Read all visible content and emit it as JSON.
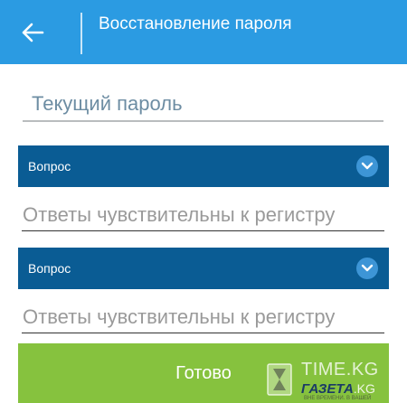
{
  "appbar": {
    "title": "Восстановление пароля",
    "color": "#2b9be2"
  },
  "form": {
    "current_password_placeholder": "Текущий пароль",
    "questions": [
      {
        "label": "Вопрос",
        "answer_placeholder": "Ответы чувствительны к регистру"
      },
      {
        "label": "Вопрос",
        "answer_placeholder": "Ответы чувствительны к регистру"
      }
    ],
    "select_color": "#0a5c94",
    "submit_label": "Готово",
    "submit_color": "#86c23e"
  },
  "watermark": {
    "name": "TIME.KG",
    "sub_main": "ГАЗЕТА",
    "sub_tail": ".KG",
    "small": "ВНЕ ВРЕМЕНИ. В ВАШЕЙ"
  },
  "icons": [
    "arrow-left-icon",
    "chevron-down-icon",
    "hourglass-icon"
  ]
}
